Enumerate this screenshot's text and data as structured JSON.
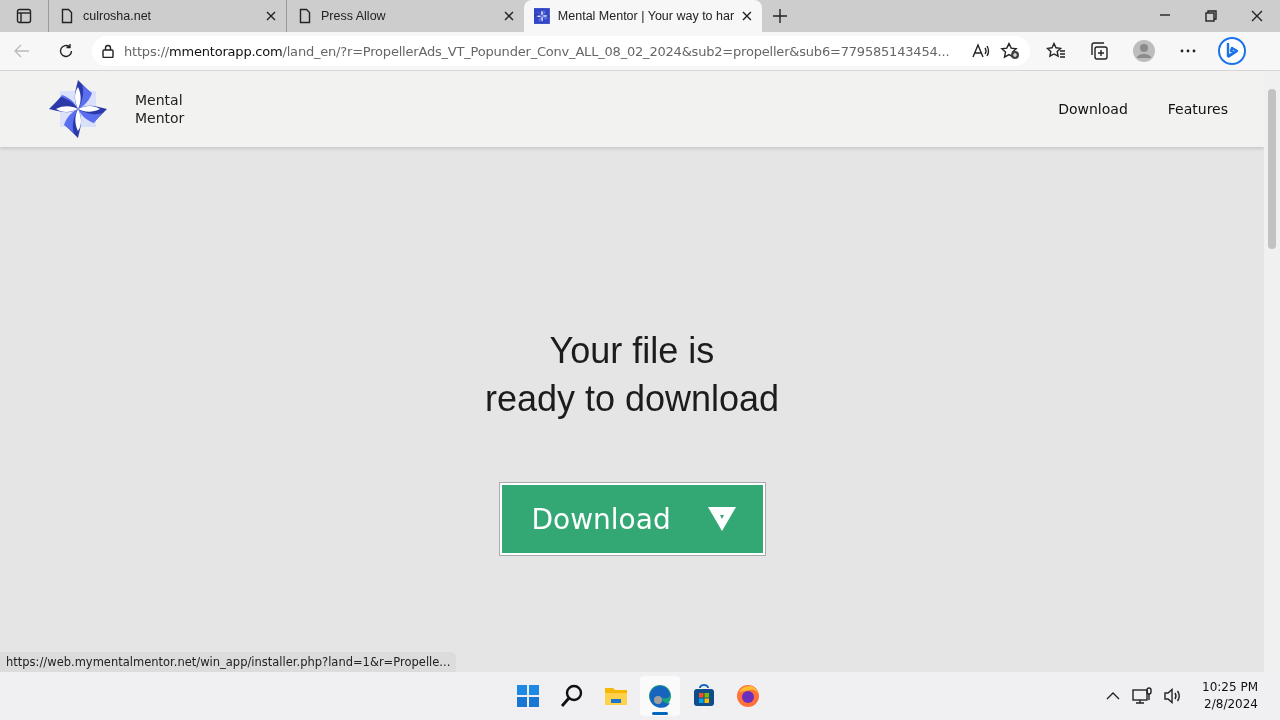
{
  "browser": {
    "tabs": [
      {
        "title": "culrosha.net",
        "kind": "page",
        "selected": false
      },
      {
        "title": "Press Allow",
        "kind": "page",
        "selected": false
      },
      {
        "title": "Mental Mentor | Your way to har",
        "kind": "site",
        "selected": true
      }
    ],
    "url": {
      "scheme": "https://",
      "host": "mmentorapp.com",
      "path": "/land_en/?r=PropellerAds_VT_Popunder_Conv_ALL_08_02_2024&sub2=propeller&sub6=779585143454..."
    }
  },
  "site": {
    "brand": [
      "Mental",
      "Mentor"
    ],
    "nav": [
      "Download",
      "Features"
    ],
    "headline": [
      "Your file is",
      "ready to download"
    ],
    "button": "Download"
  },
  "status_link": "https://web.mymentalmentor.net/win_app/installer.php?land=1&r=Propelle...",
  "taskbar": {
    "apps": [
      {
        "kind": "start",
        "selected": false
      },
      {
        "kind": "search",
        "selected": false
      },
      {
        "kind": "files",
        "selected": false
      },
      {
        "kind": "edge",
        "selected": true
      },
      {
        "kind": "store",
        "selected": false
      },
      {
        "kind": "firefox",
        "selected": false
      }
    ],
    "time": "10:25 PM",
    "date": "2/8/2024"
  }
}
